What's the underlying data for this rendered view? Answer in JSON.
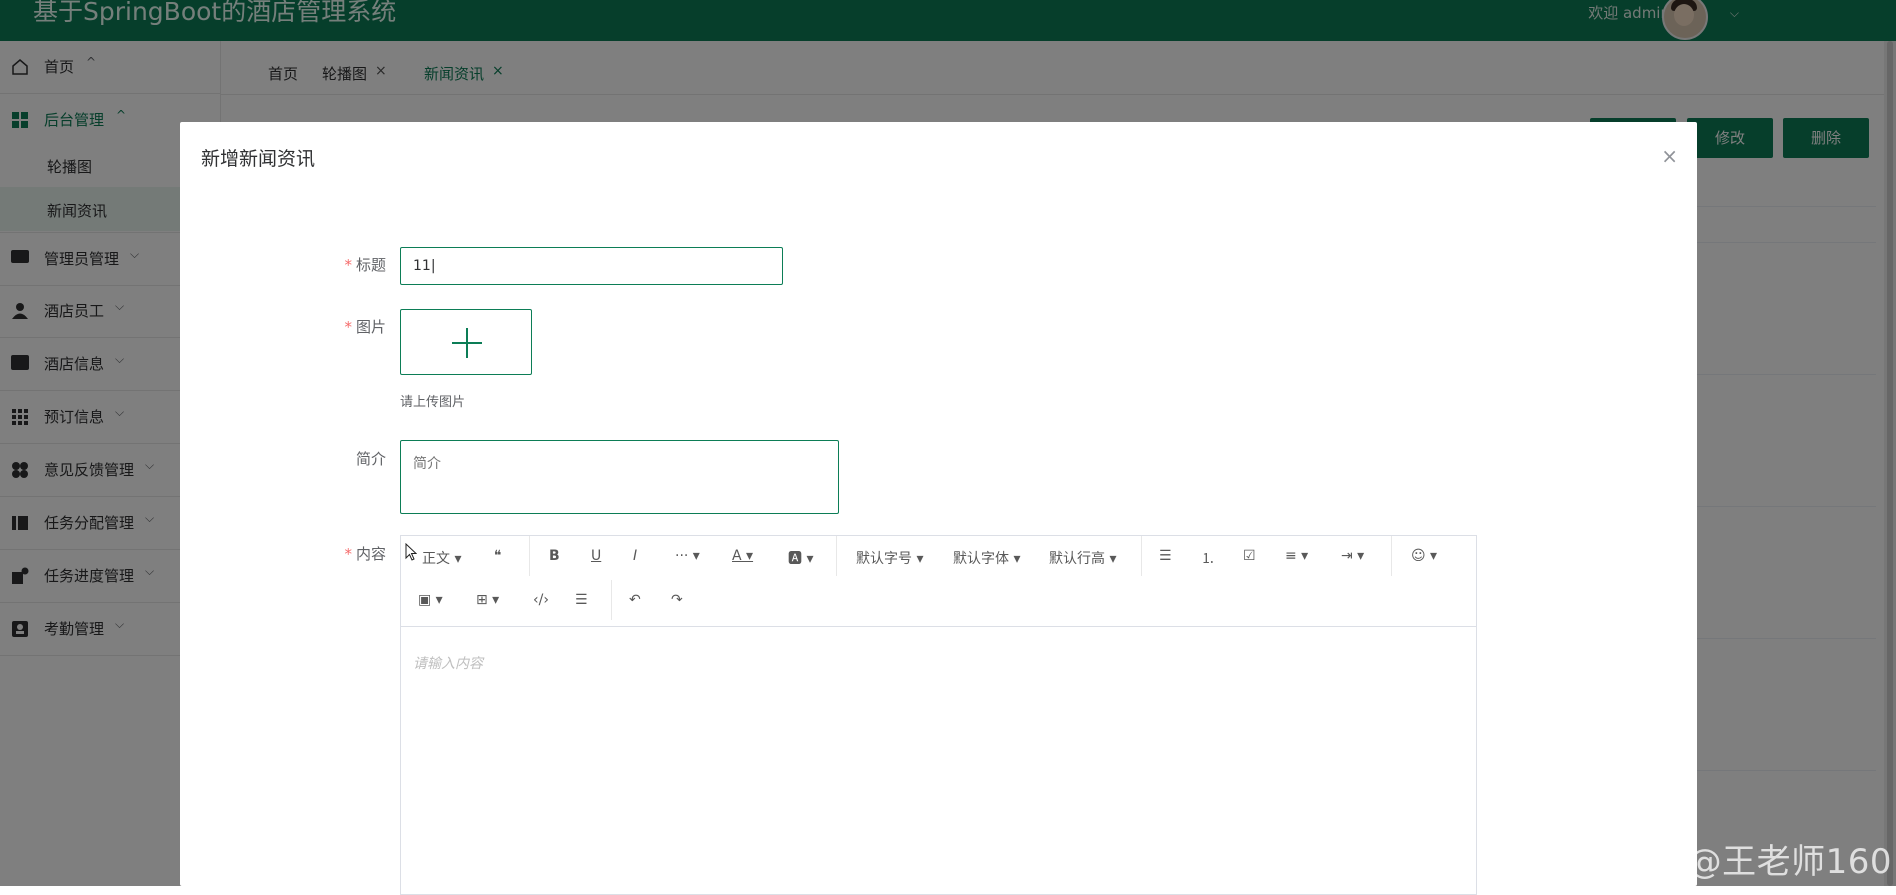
{
  "header": {
    "title": "基于SpringBoot的酒店管理系统",
    "welcome": "欢迎 admin",
    "caret": "⌵"
  },
  "sidebar": {
    "items": [
      {
        "label": "首页",
        "arrow": "^",
        "icon": "home-icon"
      },
      {
        "label": "后台管理",
        "arrow": "^",
        "icon": "grid-icon"
      },
      {
        "label": "管理员管理",
        "arrow": "⌵",
        "icon": "laptop-icon"
      },
      {
        "label": "酒店员工",
        "arrow": "⌵",
        "icon": "user-icon"
      },
      {
        "label": "酒店信息",
        "arrow": "⌵",
        "icon": "window-icon"
      },
      {
        "label": "预订信息",
        "arrow": "⌵",
        "icon": "apps-icon"
      },
      {
        "label": "意见反馈管理",
        "arrow": "⌵",
        "icon": "circles-icon"
      },
      {
        "label": "任务分配管理",
        "arrow": "⌵",
        "icon": "columns-icon"
      },
      {
        "label": "任务进度管理",
        "arrow": "⌵",
        "icon": "progress-icon"
      },
      {
        "label": "考勤管理",
        "arrow": "⌵",
        "icon": "badge-icon"
      }
    ],
    "sub_items": [
      "轮播图",
      "新闻资讯"
    ]
  },
  "tabs": [
    {
      "label": "首页"
    },
    {
      "label": "轮播图",
      "close": "×"
    },
    {
      "label": "新闻资讯",
      "close": "×"
    }
  ],
  "toolbar": {
    "edit_label": "修改",
    "delete_label": "删除"
  },
  "dialog": {
    "title": "新增新闻资讯",
    "close": "×",
    "required_mark": "*",
    "fields": {
      "title_label": "标题",
      "title_value": "11|",
      "image_label": "图片",
      "image_tip": "请上传图片",
      "intro_label": "简介",
      "intro_placeholder": "简介",
      "content_label": "内容"
    },
    "editor": {
      "toolbar": {
        "paragraph": "正文 ▾",
        "quote": "❝",
        "bold": "B",
        "underline": "U",
        "italic": "I",
        "more": "··· ▾",
        "font_color": "A ▾",
        "bg_color": "🅰 ▾",
        "font_size": "默认字号 ▾",
        "font_family": "默认字体 ▾",
        "line_height": "默认行高 ▾",
        "bullet_list": "☰",
        "number_list": "⒈",
        "todo": "☑",
        "align": "≡ ▾",
        "indent": "⇥ ▾",
        "emoji": "☺ ▾",
        "image": "▣ ▾",
        "table": "⊞ ▾",
        "code": "‹/›",
        "divider": "☰",
        "undo": "↶",
        "redo": "↷"
      },
      "placeholder": "请输入内容"
    }
  },
  "watermark": "CSDN @王老师160",
  "colors": {
    "brand": "#0c7d56"
  }
}
